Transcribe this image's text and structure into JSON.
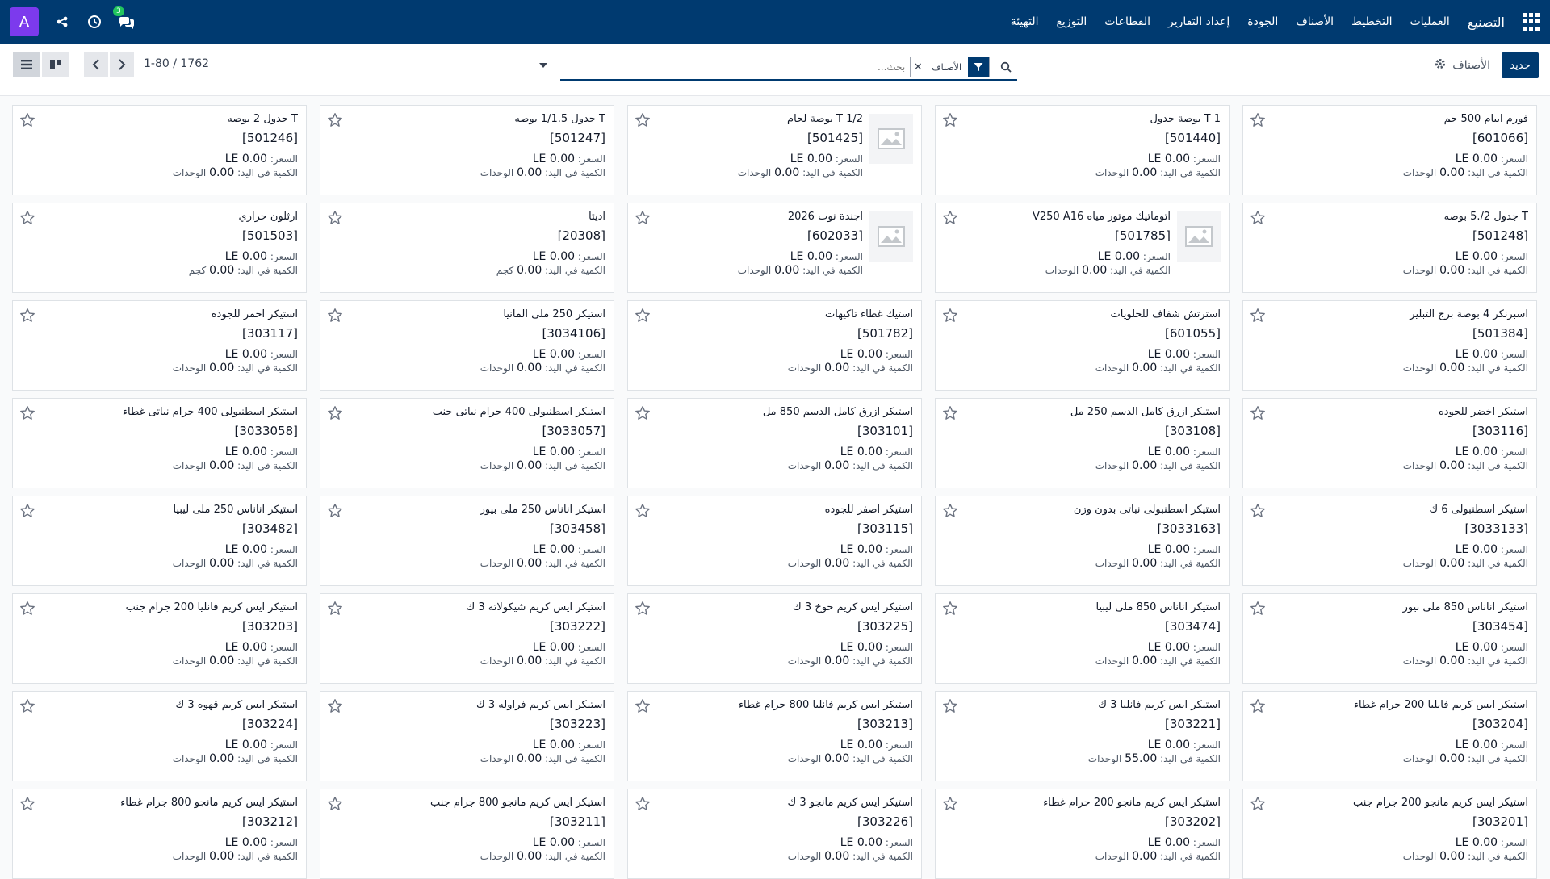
{
  "navbar": {
    "avatar_letter": "A",
    "chat_badge": "3",
    "app_name": "التصنيع",
    "menu": [
      "العمليات",
      "التخطيط",
      "الأصناف",
      "الجودة",
      "إعداد التقارير",
      "القطاعات",
      "التوزيع",
      "التهيئة"
    ],
    "icons": [
      "apps-grid-icon",
      "chat-icon",
      "clock-icon",
      "share-icon"
    ]
  },
  "control": {
    "new_button": "جديد",
    "breadcrumb": "الأصناف",
    "facet_label": "الأصناف",
    "search_placeholder": "بحث...",
    "pager": "1-80 / 1762"
  },
  "labels": {
    "price": "السعر: ",
    "on_hand": "الكمية في اليد: "
  },
  "products": [
    {
      "name": "فورم ايبام 500 جم",
      "code": "[601066]",
      "price": "0.00 LE",
      "qty": "0.00",
      "unit": "الوحدات",
      "image": false
    },
    {
      "name": "T 1 بوصة جدول",
      "code": "[501440]",
      "price": "0.00 LE",
      "qty": "0.00",
      "unit": "الوحدات",
      "image": false
    },
    {
      "name": "T 1/2 بوصة لحام",
      "code": "[501425]",
      "price": "0.00 LE",
      "qty": "0.00",
      "unit": "الوحدات",
      "image": true
    },
    {
      "name": "T جدول 1/1.5 بوصه",
      "code": "[501247]",
      "price": "0.00 LE",
      "qty": "0.00",
      "unit": "الوحدات",
      "image": false
    },
    {
      "name": "T جدول 2 بوصه",
      "code": "[501246]",
      "price": "0.00 LE",
      "qty": "0.00",
      "unit": "الوحدات",
      "image": false
    },
    {
      "name": "T جدول 2/.5 بوصه",
      "code": "[501248]",
      "price": "0.00 LE",
      "qty": "0.00",
      "unit": "الوحدات",
      "image": false
    },
    {
      "name": "اتوماتيك موتور مياه V250 A16",
      "code": "[501785]",
      "price": "0.00 LE",
      "qty": "0.00",
      "unit": "الوحدات",
      "image": true
    },
    {
      "name": "اجندة نوت 2026",
      "code": "[602033]",
      "price": "0.00 LE",
      "qty": "0.00",
      "unit": "الوحدات",
      "image": true
    },
    {
      "name": "اديتا",
      "code": "[20308]",
      "price": "0.00 LE",
      "qty": "0.00",
      "unit": "كجم",
      "image": false
    },
    {
      "name": "ارثلون حراري",
      "code": "[501503]",
      "price": "0.00 LE",
      "qty": "0.00",
      "unit": "كجم",
      "image": false
    },
    {
      "name": "اسبرنكر 4 بوصة برج التبلير",
      "code": "[501384]",
      "price": "0.00 LE",
      "qty": "0.00",
      "unit": "الوحدات",
      "image": false
    },
    {
      "name": "استرتش شفاف للحلويات",
      "code": "[601055]",
      "price": "0.00 LE",
      "qty": "0.00",
      "unit": "الوحدات",
      "image": false
    },
    {
      "name": "استيك غطاء تاكيهات",
      "code": "[501782]",
      "price": "0.00 LE",
      "qty": "0.00",
      "unit": "الوحدات",
      "image": false
    },
    {
      "name": "استيكر 250 ملى المانيا",
      "code": "[3034106]",
      "price": "0.00 LE",
      "qty": "0.00",
      "unit": "الوحدات",
      "image": false
    },
    {
      "name": "استيكر احمر للجوده",
      "code": "[303117]",
      "price": "0.00 LE",
      "qty": "0.00",
      "unit": "الوحدات",
      "image": false
    },
    {
      "name": "استيكر اخضر للجوده",
      "code": "[303116]",
      "price": "0.00 LE",
      "qty": "0.00",
      "unit": "الوحدات",
      "image": false
    },
    {
      "name": "استيكر ازرق كامل الدسم 250 مل",
      "code": "[303108]",
      "price": "0.00 LE",
      "qty": "0.00",
      "unit": "الوحدات",
      "image": false
    },
    {
      "name": "استيكر ازرق كامل الدسم 850 مل",
      "code": "[303101]",
      "price": "0.00 LE",
      "qty": "0.00",
      "unit": "الوحدات",
      "image": false
    },
    {
      "name": "استيكر اسطنبولى 400 جرام نباتى جنب",
      "code": "[3033057]",
      "price": "0.00 LE",
      "qty": "0.00",
      "unit": "الوحدات",
      "image": false
    },
    {
      "name": "استيكر اسطنبولى 400 جرام نباتى غطاء",
      "code": "[3033058]",
      "price": "0.00 LE",
      "qty": "0.00",
      "unit": "الوحدات",
      "image": false
    },
    {
      "name": "استيكر اسطنبولى 6 ك",
      "code": "[3033133]",
      "price": "0.00 LE",
      "qty": "0.00",
      "unit": "الوحدات",
      "image": false
    },
    {
      "name": "استيكر اسطنبولى نباتى بدون وزن",
      "code": "[3033163]",
      "price": "0.00 LE",
      "qty": "0.00",
      "unit": "الوحدات",
      "image": false
    },
    {
      "name": "استيكر اصفر للجوده",
      "code": "[303115]",
      "price": "0.00 LE",
      "qty": "0.00",
      "unit": "الوحدات",
      "image": false
    },
    {
      "name": "استيكر اناناس 250 ملى بيور",
      "code": "[303458]",
      "price": "0.00 LE",
      "qty": "0.00",
      "unit": "الوحدات",
      "image": false
    },
    {
      "name": "استيكر اناناس 250 ملى ليبيا",
      "code": "[303482]",
      "price": "0.00 LE",
      "qty": "0.00",
      "unit": "الوحدات",
      "image": false
    },
    {
      "name": "استيكر اناناس 850 ملى بيور",
      "code": "[303454]",
      "price": "0.00 LE",
      "qty": "0.00",
      "unit": "الوحدات",
      "image": false
    },
    {
      "name": "استيكر اناناس 850 ملى ليبيا",
      "code": "[303474]",
      "price": "0.00 LE",
      "qty": "0.00",
      "unit": "الوحدات",
      "image": false
    },
    {
      "name": "استيكر ايس كريم خوخ 3 ك",
      "code": "[303225]",
      "price": "0.00 LE",
      "qty": "0.00",
      "unit": "الوحدات",
      "image": false
    },
    {
      "name": "استيكر ايس كريم شيكولاته 3 ك",
      "code": "[303222]",
      "price": "0.00 LE",
      "qty": "0.00",
      "unit": "الوحدات",
      "image": false
    },
    {
      "name": "استيكر ايس كريم فانليا 200 جرام جنب",
      "code": "[303203]",
      "price": "0.00 LE",
      "qty": "0.00",
      "unit": "الوحدات",
      "image": false
    },
    {
      "name": "استيكر ايس كريم فانليا 200 جرام غطاء",
      "code": "[303204]",
      "price": "0.00 LE",
      "qty": "0.00",
      "unit": "الوحدات",
      "image": false
    },
    {
      "name": "استيكر ايس كريم فانليا 3 ك",
      "code": "[303221]",
      "price": "0.00 LE",
      "qty": "55.00",
      "unit": "الوحدات",
      "image": false
    },
    {
      "name": "استيكر ايس كريم فانليا 800 جرام غطاء",
      "code": "[303213]",
      "price": "0.00 LE",
      "qty": "0.00",
      "unit": "الوحدات",
      "image": false
    },
    {
      "name": "استيكر ايس كريم فراوله 3 ك",
      "code": "[303223]",
      "price": "0.00 LE",
      "qty": "0.00",
      "unit": "الوحدات",
      "image": false
    },
    {
      "name": "استيكر ايس كريم قهوه 3 ك",
      "code": "[303224]",
      "price": "0.00 LE",
      "qty": "0.00",
      "unit": "الوحدات",
      "image": false
    },
    {
      "name": "استيكر ايس كريم مانجو 200 جرام جنب",
      "code": "[303201]",
      "price": "0.00 LE",
      "qty": "0.00",
      "unit": "الوحدات",
      "image": false
    },
    {
      "name": "استيكر ايس كريم مانجو 200 جرام غطاء",
      "code": "[303202]",
      "price": "0.00 LE",
      "qty": "0.00",
      "unit": "الوحدات",
      "image": false
    },
    {
      "name": "استيكر ايس كريم مانجو 3 ك",
      "code": "[303226]",
      "price": "0.00 LE",
      "qty": "0.00",
      "unit": "الوحدات",
      "image": false
    },
    {
      "name": "استيكر ايس كريم مانجو 800 جرام جنب",
      "code": "[303211]",
      "price": "0.00 LE",
      "qty": "0.00",
      "unit": "الوحدات",
      "image": false
    },
    {
      "name": "استيكر ايس كريم مانجو 800 جرام غطاء",
      "code": "[303212]",
      "price": "0.00 LE",
      "qty": "0.00",
      "unit": "الوحدات",
      "image": false
    }
  ],
  "colors": {
    "primary": "#003a70",
    "avatar": "#7c3aed",
    "badge": "#22c55e"
  }
}
